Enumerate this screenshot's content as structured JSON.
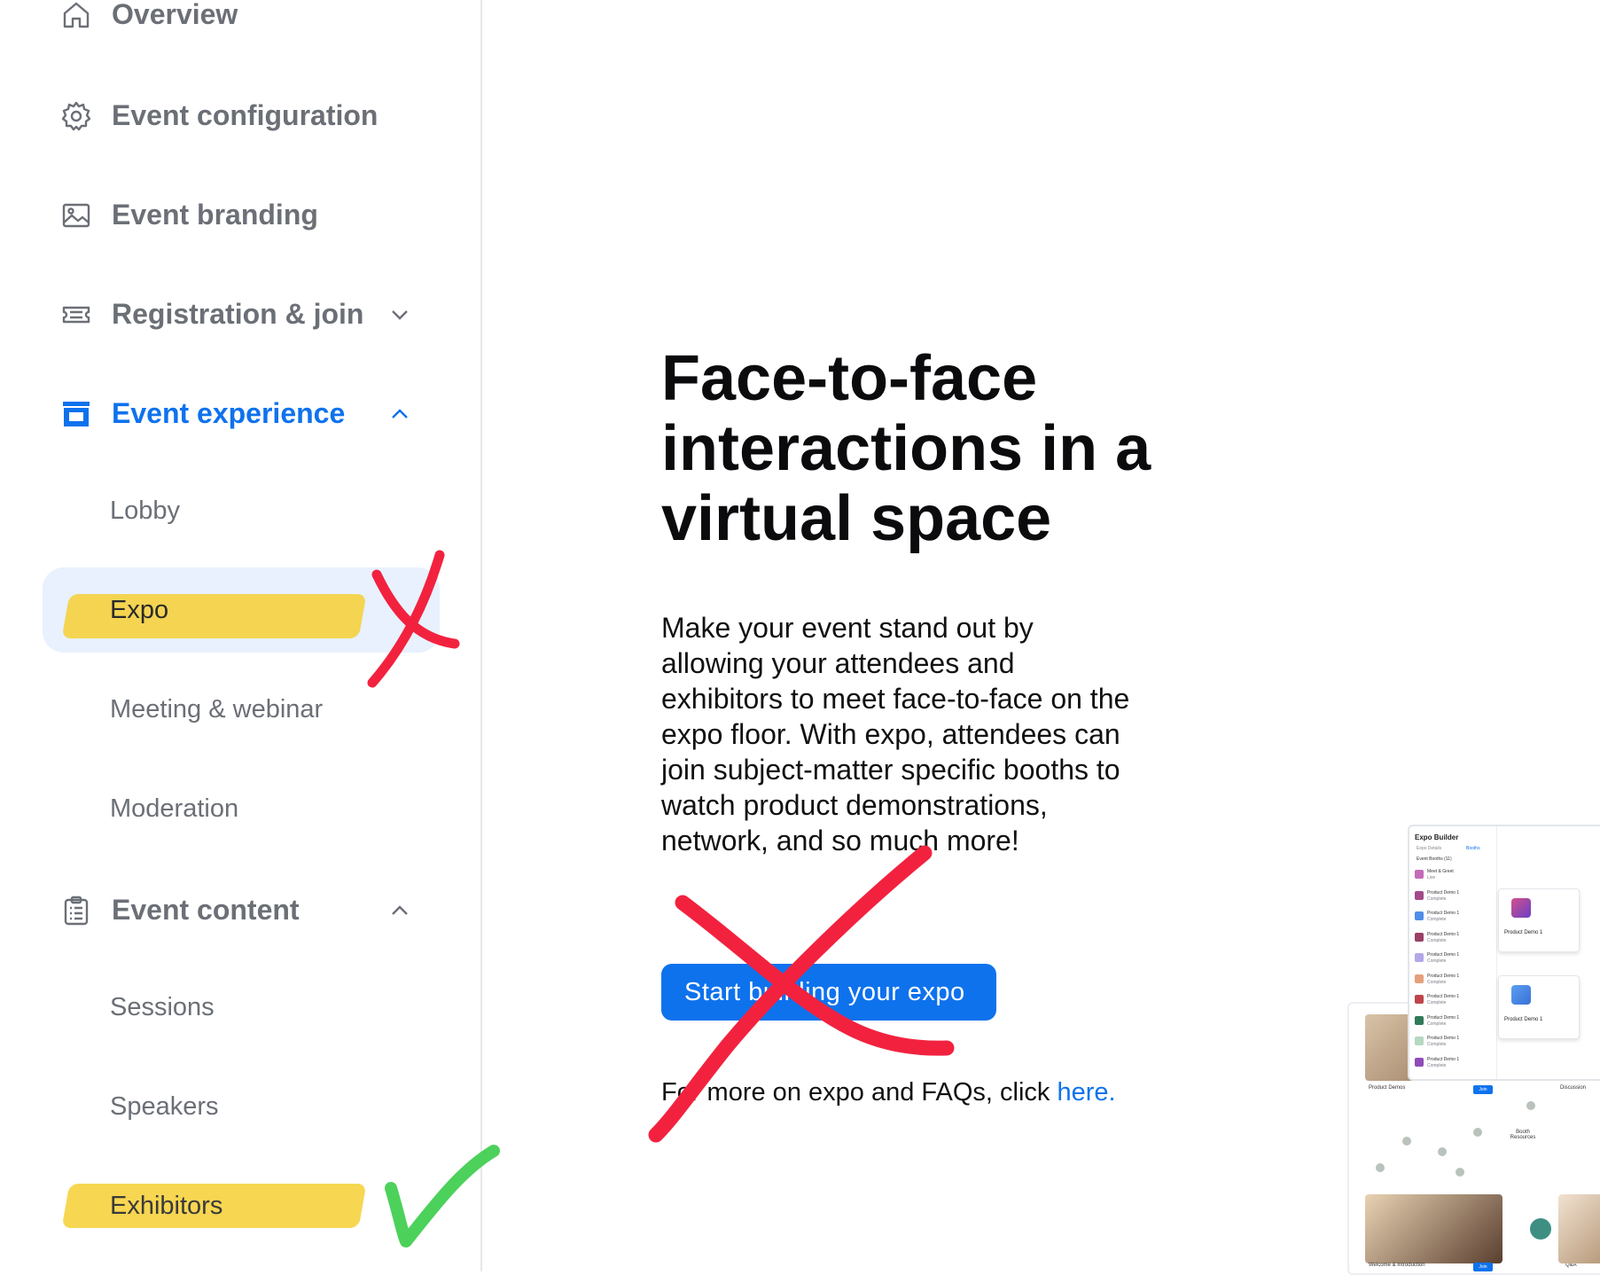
{
  "sidebar": {
    "items": [
      {
        "label": "Overview",
        "icon": "home-icon"
      },
      {
        "label": "Event configuration",
        "icon": "gear-icon"
      },
      {
        "label": "Event branding",
        "icon": "image-icon"
      },
      {
        "label": "Registration & join",
        "icon": "ticket-icon",
        "expanded": false
      },
      {
        "label": "Event experience",
        "icon": "storefront-icon",
        "expanded": true,
        "active": true
      },
      {
        "label": "Event content",
        "icon": "clipboard-icon",
        "expanded": true
      }
    ],
    "experience_subitems": [
      "Lobby",
      "Expo",
      "Meeting & webinar",
      "Moderation"
    ],
    "content_subitems": [
      "Sessions",
      "Speakers",
      "Exhibitors"
    ],
    "selected_subitem": "Expo"
  },
  "main": {
    "title": "Face-to-face interactions in a virtual space",
    "description": "Make your event stand out by allowing your attendees and exhibitors to meet face-to-face on the expo floor. With expo, attendees can join subject-matter specific booths to watch product demonstrations, network, and so much more!",
    "cta_label": "Start building your expo",
    "faq_prefix": "For more on expo and FAQs, click ",
    "faq_link": "here."
  },
  "preview": {
    "builder_title": "Expo Builder",
    "tabs": [
      "Expo Details",
      "Booths"
    ],
    "list_header": "Event Booths (11)",
    "rows": [
      {
        "label": "Meet & Greet",
        "status": "Live",
        "color": "#c46ab8"
      },
      {
        "label": "Product Demo 1",
        "status": "Complete",
        "color": "#a24a8a"
      },
      {
        "label": "Product Demo 1",
        "status": "Complete",
        "color": "#4e8de8"
      },
      {
        "label": "Product Demo 1",
        "status": "Complete",
        "color": "#9b3f66"
      },
      {
        "label": "Product Demo 1",
        "status": "Complete",
        "color": "#b3a7e8"
      },
      {
        "label": "Product Demo 1",
        "status": "Complete",
        "color": "#e4a07a"
      },
      {
        "label": "Product Demo 1",
        "status": "Complete",
        "color": "#c0444b"
      },
      {
        "label": "Product Demo 1",
        "status": "Complete",
        "color": "#2f7a5a"
      },
      {
        "label": "Product Demo 1",
        "status": "Complete",
        "color": "#b5d8c0"
      },
      {
        "label": "Product Demo 1",
        "status": "Complete",
        "color": "#8f4bb8"
      }
    ],
    "card_labels": [
      "Product Demo 1",
      "Product Demo 1"
    ],
    "floor_labels": {
      "product_demos": "Product Demos",
      "discussion": "Discussion",
      "booth_resources": "Booth Resources",
      "welcome": "Welcome & Introduction",
      "qa": "Q&A",
      "join": "Join"
    }
  },
  "annotations": {
    "red_x_color": "#f2223f",
    "green_check_color": "#4cd15b",
    "highlight_color": "#f6cf33"
  }
}
